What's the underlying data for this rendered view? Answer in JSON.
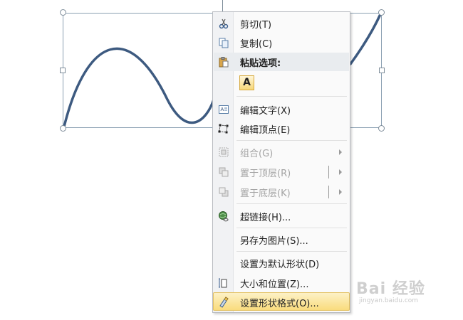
{
  "context_menu": {
    "items": [
      {
        "label": "剪切(T)",
        "icon": "scissors-icon",
        "enabled": true
      },
      {
        "label": "复制(C)",
        "icon": "copy-icon",
        "enabled": true
      },
      {
        "label": "粘贴选项:",
        "icon": "paste-icon",
        "enabled": true,
        "header": true
      },
      {
        "label": "A",
        "icon": "paste-text-only-icon",
        "enabled": true
      },
      {
        "label": "编辑文字(X)",
        "icon": "edit-text-icon",
        "enabled": true
      },
      {
        "label": "编辑顶点(E)",
        "icon": "edit-points-icon",
        "enabled": true
      },
      {
        "label": "组合(G)",
        "icon": "group-icon",
        "enabled": false,
        "submenu": true
      },
      {
        "label": "置于顶层(R)",
        "icon": "bring-to-front-icon",
        "enabled": false,
        "submenu": true
      },
      {
        "label": "置于底层(K)",
        "icon": "send-to-back-icon",
        "enabled": false,
        "submenu": true
      },
      {
        "label": "超链接(H)...",
        "icon": "hyperlink-icon",
        "enabled": true
      },
      {
        "label": "另存为图片(S)...",
        "icon": null,
        "enabled": true
      },
      {
        "label": "设置为默认形状(D)",
        "icon": null,
        "enabled": true
      },
      {
        "label": "大小和位置(Z)...",
        "icon": "size-position-icon",
        "enabled": true
      },
      {
        "label": "设置形状格式(O)...",
        "icon": "format-shape-icon",
        "enabled": true,
        "highlighted": true
      }
    ]
  },
  "watermark": {
    "text": "Bai 经验",
    "subtext": "jingyan.baidu.com"
  },
  "colors": {
    "curve": "#3d5a80",
    "highlight": "#f9dc7d",
    "menu_bg": "#fafafa",
    "disabled_text": "#a4a4a4"
  }
}
